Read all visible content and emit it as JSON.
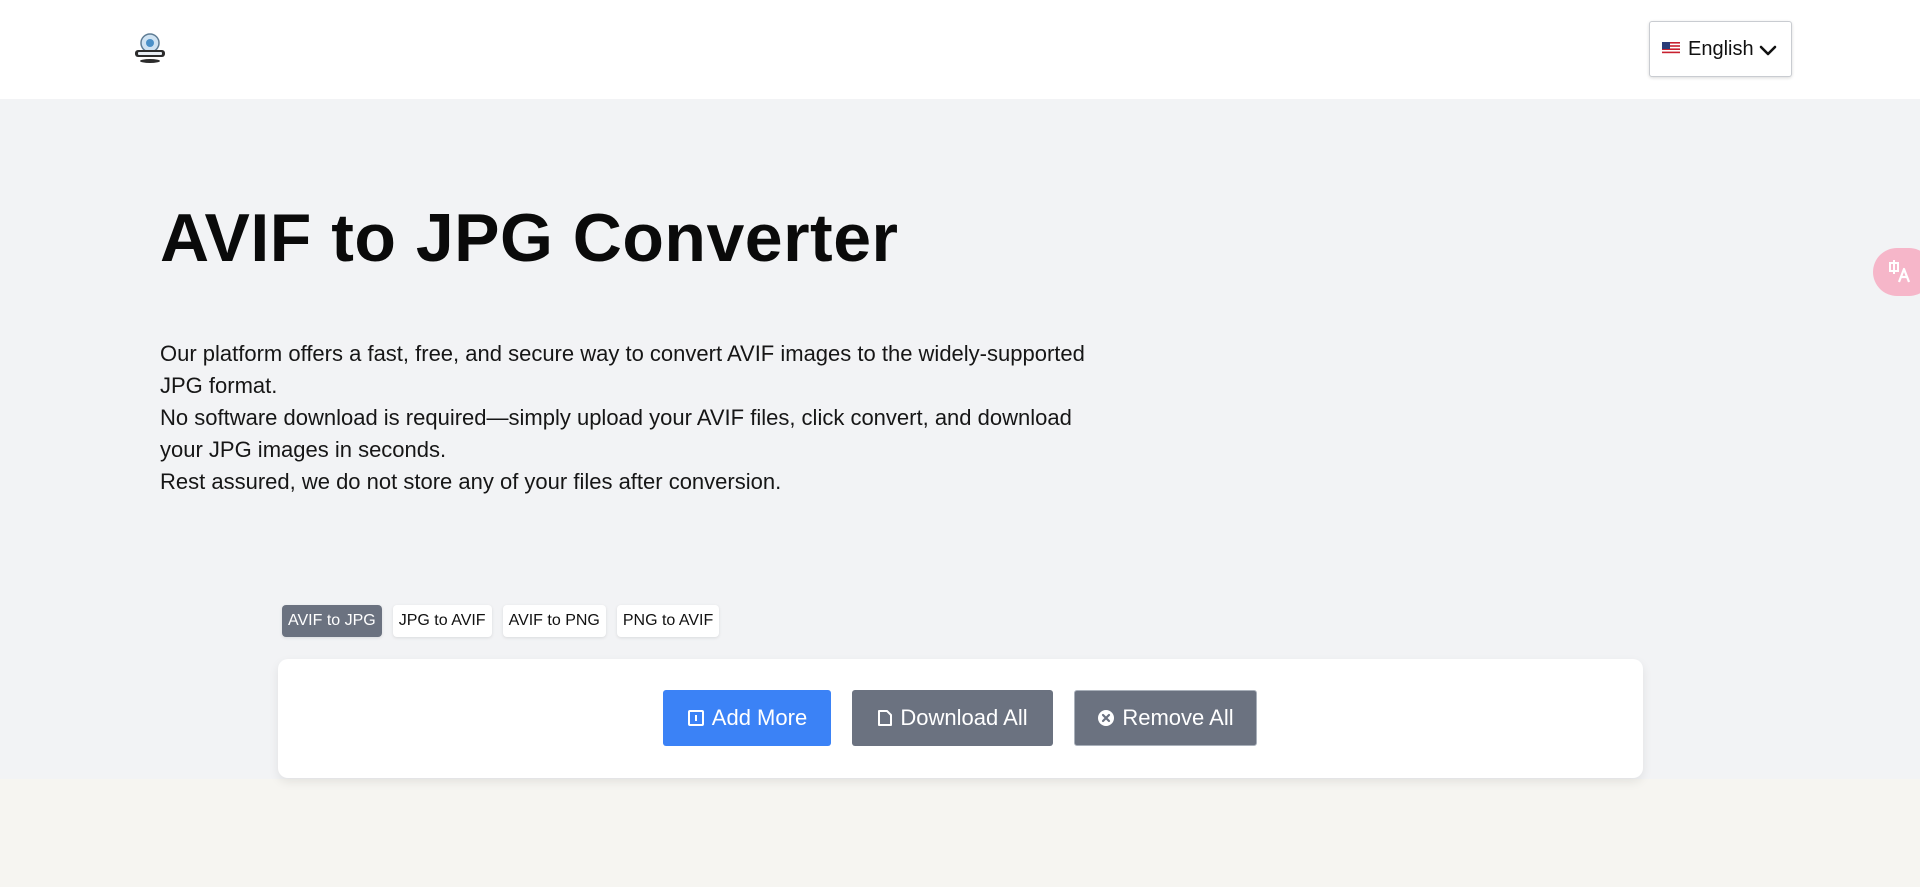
{
  "header": {
    "logo_icon": "logo-icon",
    "language": {
      "flag_icon": "us-flag-icon",
      "selected": "English"
    }
  },
  "hero": {
    "title": "AVIF to JPG Converter",
    "description": [
      "Our platform offers a fast, free, and secure way to convert AVIF images to the widely-supported JPG format.",
      "No software download is required—simply upload your AVIF files, click convert, and download your JPG images in seconds.",
      "Rest assured, we do not store any of your files after conversion."
    ]
  },
  "tabs": [
    {
      "label": "AVIF to JPG",
      "active": true
    },
    {
      "label": "JPG to AVIF",
      "active": false
    },
    {
      "label": "AVIF to PNG",
      "active": false
    },
    {
      "label": "PNG to AVIF",
      "active": false
    }
  ],
  "toolbar": {
    "add_label": "Add More",
    "download_label": "Download All",
    "remove_label": "Remove All"
  },
  "colors": {
    "accent": "#3b82f6",
    "secondary": "#6b7280",
    "hero_bg": "#f2f3f5",
    "translate_fab": "#f6b6c9"
  },
  "translate_fab_icon": "translate-icon"
}
